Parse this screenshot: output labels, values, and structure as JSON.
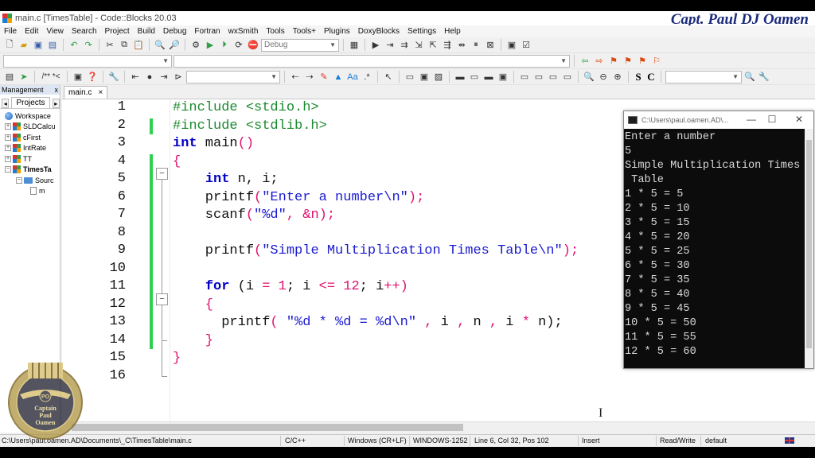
{
  "window": {
    "title": "main.c [TimesTable] - Code::Blocks 20.03",
    "watermark": "Capt. Paul DJ Oamen"
  },
  "menu": [
    "File",
    "Edit",
    "View",
    "Search",
    "Project",
    "Build",
    "Debug",
    "Fortran",
    "wxSmith",
    "Tools",
    "Tools+",
    "Plugins",
    "DoxyBlocks",
    "Settings",
    "Help"
  ],
  "toolbar": {
    "build_target": "Debug",
    "comment_block_label": "/** *<"
  },
  "management": {
    "title": "Management",
    "close_glyph": "x",
    "tab": "Projects",
    "tree": [
      {
        "label": "Workspace",
        "kind": "workspace"
      },
      {
        "label": "SLDCalcu",
        "kind": "project"
      },
      {
        "label": "cFirst",
        "kind": "project"
      },
      {
        "label": "IntRate",
        "kind": "project"
      },
      {
        "label": "TT",
        "kind": "project"
      },
      {
        "label": "TimesTa",
        "kind": "project-active"
      },
      {
        "label": "Sourc",
        "kind": "folder"
      },
      {
        "label": "m",
        "kind": "file"
      }
    ]
  },
  "editor": {
    "tab_label": "main.c",
    "tab_close": "×",
    "line_numbers": [
      "1",
      "2",
      "3",
      "4",
      "5",
      "6",
      "7",
      "8",
      "9",
      "10",
      "11",
      "12",
      "13",
      "14",
      "15",
      "16"
    ],
    "lines": [
      [
        {
          "t": "#include <stdio.h>",
          "c": "pp"
        }
      ],
      [
        {
          "t": "#include <stdlib.h>",
          "c": "pp"
        }
      ],
      [
        {
          "t": "int",
          "c": "kw"
        },
        {
          "t": " main",
          "c": "tx"
        },
        {
          "t": "()",
          "c": "op"
        }
      ],
      [
        {
          "t": "{",
          "c": "op"
        }
      ],
      [
        {
          "t": "    ",
          "c": "tx"
        },
        {
          "t": "int",
          "c": "kw"
        },
        {
          "t": " n, i;",
          "c": "tx"
        }
      ],
      [
        {
          "t": "    printf",
          "c": "tx"
        },
        {
          "t": "(",
          "c": "op"
        },
        {
          "t": "\"Enter a number\\n\"",
          "c": "st"
        },
        {
          "t": ");",
          "c": "op"
        }
      ],
      [
        {
          "t": "    scanf",
          "c": "tx"
        },
        {
          "t": "(",
          "c": "op"
        },
        {
          "t": "\"%d\"",
          "c": "st"
        },
        {
          "t": ", &n);",
          "c": "op"
        }
      ],
      [],
      [
        {
          "t": "    printf",
          "c": "tx"
        },
        {
          "t": "(",
          "c": "op"
        },
        {
          "t": "\"Simple Multiplication Times Table\\n\"",
          "c": "st"
        },
        {
          "t": ");",
          "c": "op"
        }
      ],
      [],
      [
        {
          "t": "    ",
          "c": "tx"
        },
        {
          "t": "for",
          "c": "kw"
        },
        {
          "t": " (i ",
          "c": "tx"
        },
        {
          "t": "=",
          "c": "op"
        },
        {
          "t": " ",
          "c": "tx"
        },
        {
          "t": "1",
          "c": "nm"
        },
        {
          "t": "; i ",
          "c": "tx"
        },
        {
          "t": "<=",
          "c": "op"
        },
        {
          "t": " ",
          "c": "tx"
        },
        {
          "t": "12",
          "c": "nm"
        },
        {
          "t": "; i",
          "c": "tx"
        },
        {
          "t": "++)",
          "c": "op"
        }
      ],
      [
        {
          "t": "    {",
          "c": "op"
        }
      ],
      [
        {
          "t": "      printf",
          "c": "tx"
        },
        {
          "t": "( ",
          "c": "op"
        },
        {
          "t": "\"%d * %d = %d\\n\"",
          "c": "st"
        },
        {
          "t": " , ",
          "c": "op"
        },
        {
          "t": "i",
          "c": "tx"
        },
        {
          "t": " , ",
          "c": "op"
        },
        {
          "t": "n",
          "c": "tx"
        },
        {
          "t": " , ",
          "c": "op"
        },
        {
          "t": "i ",
          "c": "tx"
        },
        {
          "t": "*",
          "c": "op"
        },
        {
          "t": " n);",
          "c": "tx"
        }
      ],
      [
        {
          "t": "    }",
          "c": "op"
        }
      ],
      [
        {
          "t": "}",
          "c": "op"
        }
      ],
      []
    ]
  },
  "console": {
    "title": "C:\\Users\\paul.oamen.AD\\...",
    "minimize": "—",
    "maximize": "☐",
    "close": "✕",
    "output": [
      "Enter a number",
      "5",
      "Simple Multiplication Times",
      " Table",
      "1 * 5 = 5",
      "2 * 5 = 10",
      "3 * 5 = 15",
      "4 * 5 = 20",
      "5 * 5 = 25",
      "6 * 5 = 30",
      "7 * 5 = 35",
      "8 * 5 = 40",
      "9 * 5 = 45",
      "10 * 5 = 50",
      "11 * 5 = 55",
      "12 * 5 = 60"
    ]
  },
  "status": {
    "path": "C:\\Users\\paul.oamen.AD\\Documents\\_C\\TimesTable\\main.c",
    "language": "C/C++",
    "eol": "Windows (CR+LF)",
    "encoding": "WINDOWS-1252",
    "position": "Line 6, Col 32, Pos 102",
    "mode": "Insert",
    "access": "Read/Write",
    "profile": "default"
  },
  "emblem": {
    "initials": "PO",
    "line1": "Captain",
    "line2": "Paul",
    "line3": "Oamen"
  },
  "colors": {
    "preprocessor": "#1b8a2f",
    "keyword": "#0000c8",
    "string": "#1a1ad0",
    "operator": "#e0106e",
    "change_marker": "#2fd04f",
    "console_bg": "#0c0c0c"
  }
}
